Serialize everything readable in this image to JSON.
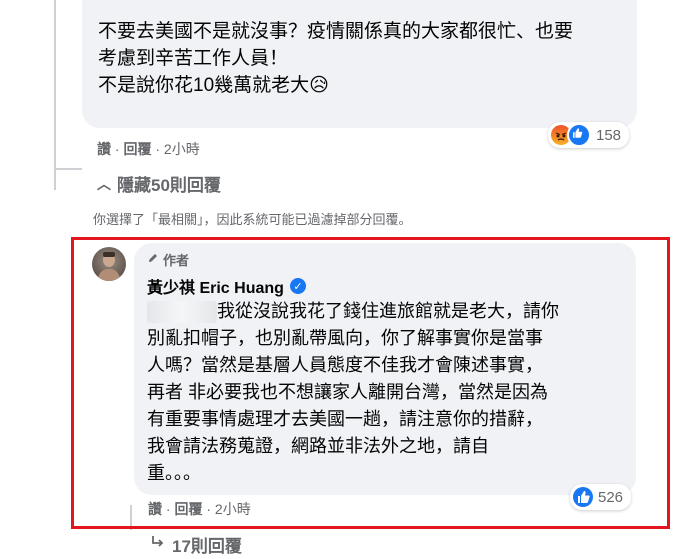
{
  "top_comment": {
    "text_line1": "不要去美國不是就沒事？疫情關係真的大家都很忙、也要",
    "text_line2": "考慮到辛苦工作人員！",
    "text_line3": "不是說你花10幾萬就老大",
    "text_emoji": "😥",
    "reaction_count": "158",
    "actions": {
      "like": "讚",
      "reply": "回覆",
      "time": "2小時"
    }
  },
  "hide_replies": {
    "label": "隱藏50則回覆"
  },
  "filter_notice": "你選擇了「最相關」，因此系統可能已過濾掉部分回覆。",
  "reply": {
    "author_tag": "作者",
    "author_name": "黃少祺 Eric Huang",
    "text_line1": "我從沒說我花了錢住進旅館就是老大，請你",
    "text_line2": "別亂扣帽子，也別亂帶風向，你了解事實你是當事",
    "text_line3": "人嗎？當然是基層人員態度不佳我才會陳述事實，",
    "text_line4": "再者 非必要我也不想讓家人離開台灣，當然是因為",
    "text_line5": "有重要事情處理才去美國一趟，請注意你的措辭，",
    "text_line6": "我會請法務蒐證，網路並非法外之地，請自",
    "text_line7": "重。。。",
    "reaction_count": "526",
    "actions": {
      "like": "讚",
      "reply": "回覆",
      "time": "2小時"
    }
  },
  "more_replies": {
    "label": "17則回覆"
  },
  "colors": {
    "highlight": "#e3151e",
    "like_blue": "#1877f2",
    "bubble": "#f0f2f5"
  },
  "icons": [
    "pencil-icon",
    "verified-badge-icon",
    "angry-reaction-icon",
    "like-reaction-icon",
    "reply-arrow-icon"
  ]
}
